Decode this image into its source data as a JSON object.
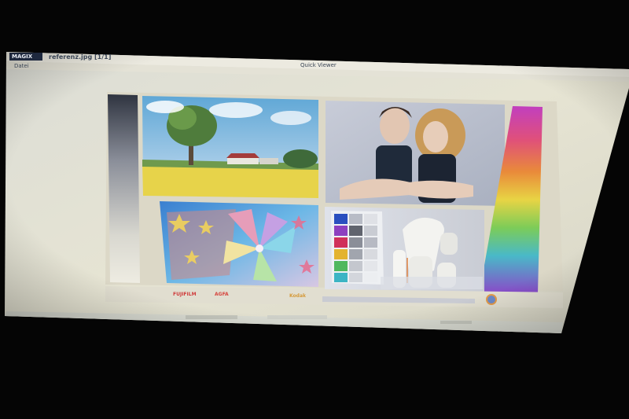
{
  "window": {
    "app_badge": "MAGIX",
    "filename": "referenz.jpg [1/1]",
    "center_title": "Quick Viewer",
    "menu_item": "Datei",
    "status_left": "",
    "status_right": ""
  },
  "brands": {
    "fujifilm": "FUJIFILM",
    "agfa": "AGFA",
    "kodak": "Kodak"
  },
  "colors": {
    "bezel": "#050505",
    "panel": "#e3e1cf",
    "titlebar": "#e9e8dd",
    "image_bg": "#ddd9c9",
    "fujifilm_red": "#cf3b3b",
    "agfa_red": "#d6463f",
    "kodak_orange": "#d59a3a"
  },
  "photo_tiles": [
    {
      "name": "landscape-photo"
    },
    {
      "name": "portrait-photo"
    },
    {
      "name": "pinwheel-photo"
    },
    {
      "name": "colorchart-photo"
    }
  ]
}
